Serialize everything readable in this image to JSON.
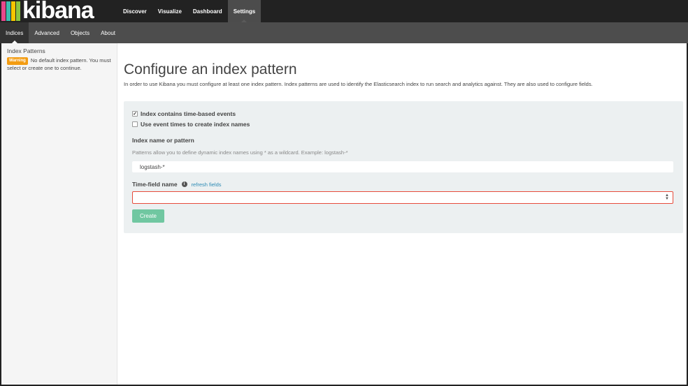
{
  "brand": {
    "name": "kibana",
    "bar_colors": [
      "#e8488b",
      "#3cbeb1",
      "#f6c600",
      "#8ec63f"
    ]
  },
  "topnav": {
    "items": [
      {
        "label": "Discover"
      },
      {
        "label": "Visualize"
      },
      {
        "label": "Dashboard"
      },
      {
        "label": "Settings"
      }
    ],
    "active": "Settings"
  },
  "subnav": {
    "items": [
      {
        "label": "Indices"
      },
      {
        "label": "Advanced"
      },
      {
        "label": "Objects"
      },
      {
        "label": "About"
      }
    ],
    "active": "Indices"
  },
  "sidebar": {
    "title": "Index Patterns",
    "warning_badge": "Warning",
    "warning_text": "No default index pattern. You must select or create one to continue."
  },
  "main": {
    "title": "Configure an index pattern",
    "intro": "In order to use Kibana you must configure at least one index pattern. Index patterns are used to identify the Elasticsearch index to run search and analytics against. They are also used to configure fields.",
    "checkboxes": [
      {
        "label": "Index contains time-based events",
        "checked": true
      },
      {
        "label": "Use event times to create index names",
        "checked": false
      }
    ],
    "index_name_label": "Index name or pattern",
    "index_help": "Patterns allow you to define dynamic index names using * as a wildcard. Example: logstash-*",
    "index_value": "logstash-*",
    "time_field_label": "Time-field name",
    "refresh_link": "refresh fields",
    "time_field_value": "",
    "create_label": "Create"
  },
  "colors": {
    "topbar": "#222222",
    "subbar": "#4d4d4d",
    "panel": "#ecf0f1",
    "create_button": "#70c7a1",
    "error_border": "#e74c3c",
    "warning_badge": "#f39c12",
    "link": "#2e8bb5"
  }
}
